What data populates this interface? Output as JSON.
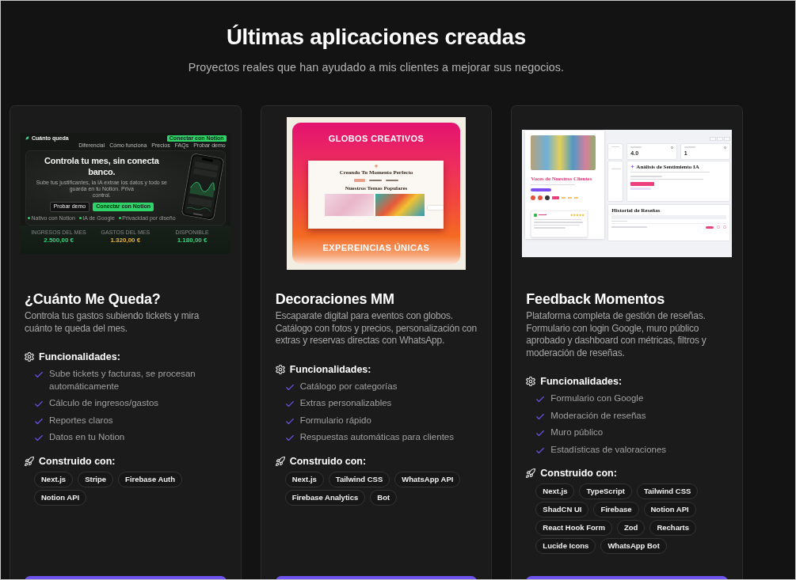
{
  "header": {
    "title": "Últimas aplicaciones creadas",
    "subtitle": "Proyectos reales que han ayudado a mis clientes a mejorar sus negocios."
  },
  "projects": [
    {
      "preview": {
        "kind": "finance",
        "brand": "Cuánto queda",
        "nav": [
          "Diferencial",
          "Cómo funciona",
          "Precios",
          "FAQs",
          "Probar demo"
        ],
        "nav_button": "Conectar con Notion",
        "headline": [
          "Controla tu mes, sin conecta",
          "banco."
        ],
        "subtitle": [
          "Sube tus justificantes, la IA extrae los datos y todo se guarda en tu Notion. Priva",
          "control."
        ],
        "buttons": [
          "Probar demo",
          "Conectar con Notion"
        ],
        "chips": [
          "Nativo con Notion",
          "IA de Google",
          "Privacidad por diseño"
        ],
        "stats": [
          {
            "label": "INGRESOS DEL MES",
            "value": "2.500,00 €",
            "color": "#35d07f"
          },
          {
            "label": "GASTOS DEL MES",
            "value": "1.320,00 €",
            "color": "#e8b33a"
          },
          {
            "label": "DISPONIBLE",
            "value": "1.180,00 €",
            "color": "#35d07f"
          }
        ]
      },
      "title": "¿Cuánto Me Queda?",
      "description": "Controla tus gastos subiendo tickets y mira cuánto te queda del mes.",
      "features_heading": "Funcionalidades:",
      "features": [
        "Sube tickets y facturas, se procesan automáticamente",
        "Cálculo de ingresos/gastos",
        "Reportes claros",
        "Datos en tu Notion"
      ],
      "stack_heading": "Construido con:",
      "stack": [
        "Next.js",
        "Stripe",
        "Firebase Auth",
        "Notion API"
      ]
    },
    {
      "preview": {
        "kind": "poster",
        "headline": "GLOBOS CREATIVOS",
        "page_title": "Creando Tu Momento Perfecto",
        "section_title": "Nuestros Temas Populares",
        "footer": "EXPEREINCIAS ÚNICAS"
      },
      "title": "Decoraciones MM",
      "description": "Escaparate digital para eventos con globos. Catálogo con fotos y precios, personalización con extras y reservas directas con WhatsApp.",
      "features_heading": "Funcionalidades:",
      "features": [
        "Catálogo por categorías",
        "Extras personalizables",
        "Formulario rápido",
        "Respuestas automáticas para clientes"
      ],
      "stack_heading": "Construido con:",
      "stack": [
        "Next.js",
        "Tailwind CSS",
        "WhatsApp API",
        "Firebase Analytics",
        "Bot"
      ]
    },
    {
      "preview": {
        "kind": "dashboard",
        "panel_title": "Voces de Nuestros Clientes",
        "stats": [
          "4.0",
          "1"
        ],
        "analysis_title": "Análisis de Sentimiento IA",
        "history_title": "Historial de Reseñas"
      },
      "title": "Feedback Momentos",
      "description": "Plataforma completa de gestión de reseñas. Formulario con login Google, muro público aprobado y dashboard con métricas, filtros y moderación de reseñas.",
      "features_heading": "Funcionalidades:",
      "features": [
        "Formulario con Google",
        "Moderación de reseñas",
        "Muro público",
        "Estadísticas de valoraciones"
      ],
      "stack_heading": "Construido con:",
      "stack": [
        "Next.js",
        "TypeScript",
        "Tailwind CSS",
        "ShadCN UI",
        "Firebase",
        "Notion API",
        "React Hook Form",
        "Zod",
        "Recharts",
        "Lucide Icons",
        "WhatsApp Bot"
      ]
    }
  ]
}
